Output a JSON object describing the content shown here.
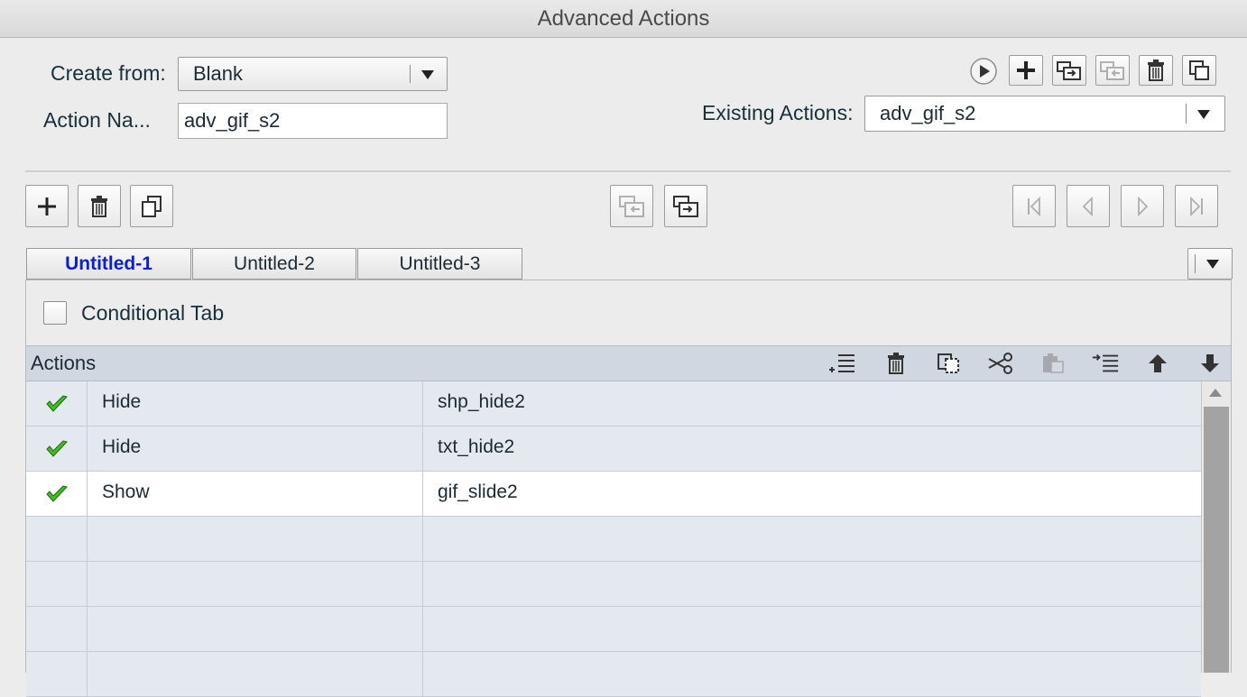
{
  "window": {
    "title": "Advanced Actions"
  },
  "form": {
    "create_from_label": "Create from:",
    "create_from_value": "Blank",
    "action_name_label": "Action Na...",
    "action_name_value": "adv_gif_s2",
    "existing_actions_label": "Existing Actions:",
    "existing_actions_value": "adv_gif_s2"
  },
  "tabs": [
    {
      "label": "Untitled-1",
      "active": true
    },
    {
      "label": "Untitled-2",
      "active": false
    },
    {
      "label": "Untitled-3",
      "active": false
    }
  ],
  "conditional_tab": {
    "label": "Conditional Tab",
    "checked": false
  },
  "actions_panel": {
    "title": "Actions",
    "rows": [
      {
        "action": "Hide",
        "target": "shp_hide2",
        "valid": true
      },
      {
        "action": "Hide",
        "target": "txt_hide2",
        "valid": true
      },
      {
        "action": "Show",
        "target": "gif_slide2",
        "valid": true
      },
      {
        "action": "",
        "target": "",
        "valid": false
      },
      {
        "action": "",
        "target": "",
        "valid": false
      },
      {
        "action": "",
        "target": "",
        "valid": false
      },
      {
        "action": "",
        "target": "",
        "valid": false
      }
    ]
  },
  "colors": {
    "active_tab": "#0a1ee0",
    "check": "#3fbf1f",
    "selected_row": "#ffffff",
    "row_bg": "#e4e8ef",
    "actions_header": "#d1d7e1"
  }
}
